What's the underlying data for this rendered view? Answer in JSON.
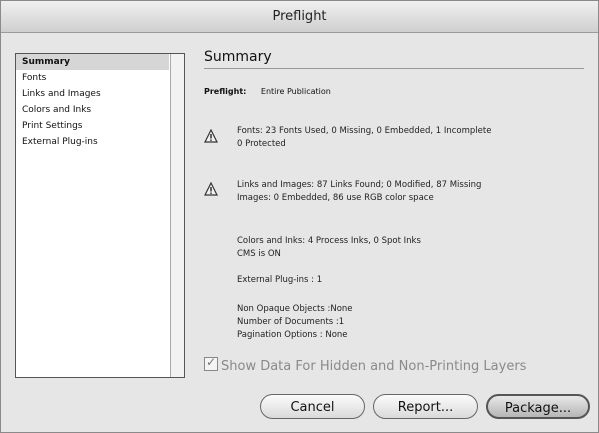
{
  "window": {
    "title": "Preflight"
  },
  "sidebar": {
    "items": [
      {
        "label": "Summary"
      },
      {
        "label": "Fonts"
      },
      {
        "label": "Links and Images"
      },
      {
        "label": "Colors and Inks"
      },
      {
        "label": "Print Settings"
      },
      {
        "label": "External Plug-ins"
      }
    ]
  },
  "main": {
    "heading": "Summary",
    "preflight_label": "Preflight:",
    "preflight_value": "Entire Publication",
    "fonts_line1": "Fonts: 23 Fonts Used, 0 Missing, 0 Embedded, 1 Incomplete",
    "fonts_line2": "0 Protected",
    "links_line1": "Links and Images: 87 Links Found; 0 Modified, 87 Missing",
    "links_line2": "Images: 0 Embedded, 86 use RGB color space",
    "colors_line1": "Colors and Inks: 4 Process Inks, 0 Spot Inks",
    "colors_line2": "CMS is ON",
    "plugins_line": "External Plug-ins : 1",
    "nonopaque_line": "Non Opaque Objects :None",
    "docs_line": "Number of Documents :1",
    "pagination_line": "Pagination Options : None",
    "show_hidden_label": "Show Data For Hidden and Non-Printing Layers",
    "show_hidden_checked": true
  },
  "buttons": {
    "cancel": "Cancel",
    "report": "Report...",
    "package": "Package..."
  }
}
